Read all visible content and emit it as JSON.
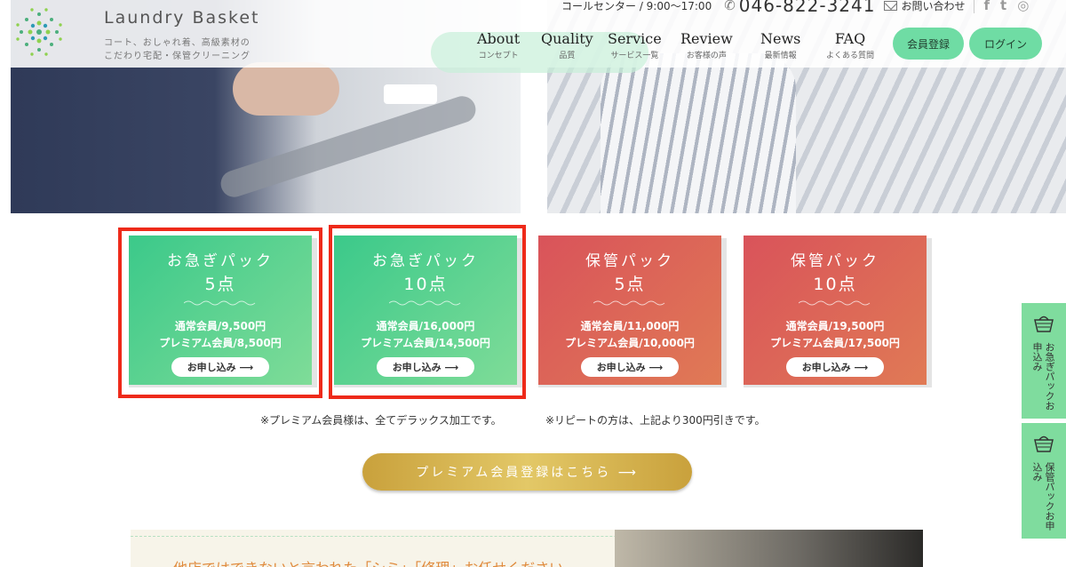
{
  "header": {
    "logo_title": "Laundry Basket",
    "logo_sub1": "コート、おしゃれ着、高級素材の",
    "logo_sub2": "こだわり宅配・保管クリーニング",
    "call_center": "コールセンター / 9:00〜17:00",
    "phone": "046-822-3241",
    "contact": "お問い合わせ",
    "sns": {
      "facebook": "f",
      "twitter": "t",
      "instagram": "◎"
    },
    "nav": [
      {
        "en": "About",
        "ja": "コンセプト"
      },
      {
        "en": "Quality",
        "ja": "品質"
      },
      {
        "en": "Service",
        "ja": "サービス一覧"
      },
      {
        "en": "Review",
        "ja": "お客様の声"
      },
      {
        "en": "News",
        "ja": "最新情報"
      },
      {
        "en": "FAQ",
        "ja": "よくある質問"
      }
    ],
    "register_label": "会員登録",
    "login_label": "ログイン"
  },
  "cards": [
    {
      "title": "お急ぎパック",
      "count": "5点",
      "regular": "通常会員/9,500円",
      "premium": "プレミアム会員/8,500円",
      "apply": "お申し込み ⟶",
      "color": "green",
      "highlighted": true
    },
    {
      "title": "お急ぎパック",
      "count": "10点",
      "regular": "通常会員/16,000円",
      "premium": "プレミアム会員/14,500円",
      "apply": "お申し込み ⟶",
      "color": "green",
      "highlighted": true
    },
    {
      "title": "保管パック",
      "count": "5点",
      "regular": "通常会員/11,000円",
      "premium": "プレミアム会員/10,000円",
      "apply": "お申し込み ⟶",
      "color": "red",
      "highlighted": false
    },
    {
      "title": "保管パック",
      "count": "10点",
      "regular": "通常会員/19,500円",
      "premium": "プレミアム会員/17,500円",
      "apply": "お申し込み ⟶",
      "color": "red",
      "highlighted": false
    }
  ],
  "notes": {
    "deluxe": "※プレミアム会員様は、全てデラックス加工です。",
    "repeat": "※リピートの方は、上記より300円引きです。"
  },
  "premium_button": "プレミアム会員登録はこちら ⟶",
  "bottom_text": "他店ではできないと言われた「シミ」「修理」お任せください",
  "side_tabs": [
    {
      "label": "お急ぎパックお申込み",
      "icon": "basket-icon"
    },
    {
      "label": "保管パックお申込み",
      "icon": "basket-icon"
    }
  ],
  "colors": {
    "green_accent": "#6fdca4",
    "highlight_frame": "#ee2a1a",
    "gold_button": "#d4b04e"
  }
}
